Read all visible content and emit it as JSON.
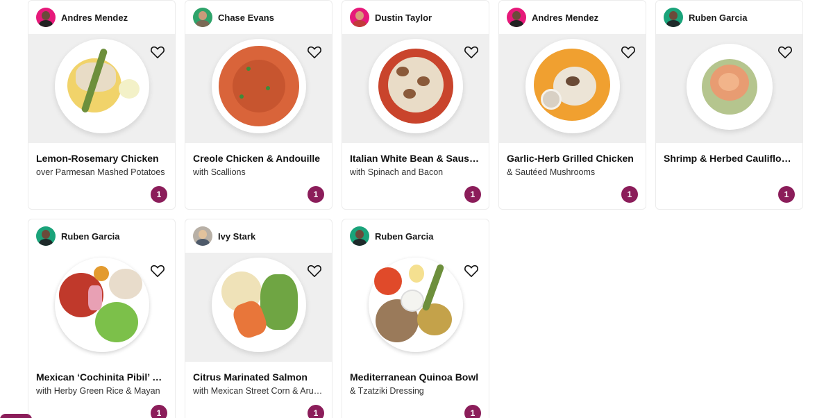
{
  "colors": {
    "accent": "#8b1d5a",
    "card_border": "#ececec",
    "photo_bg": "#efefef"
  },
  "cards": [
    {
      "chef": "Andres Mendez",
      "title": "Lemon-Rosemary Chicken",
      "subtitle": "over Parmesan Mashed Potatoes",
      "quantity": "1",
      "avatar_color": "#e6197a",
      "food": "yellow-mash-chicken"
    },
    {
      "chef": "Chase Evans",
      "title": "Creole Chicken & Andouille",
      "subtitle": "with Scallions",
      "quantity": "1",
      "avatar_color": "#2ea36a",
      "food": "red-rice"
    },
    {
      "chef": "Dustin Taylor",
      "title": "Italian White Bean & Sausage",
      "subtitle": "with Spinach and Bacon",
      "quantity": "1",
      "avatar_color": "#e6197a",
      "food": "bean-stew"
    },
    {
      "chef": "Andres Mendez",
      "title": "Garlic-Herb Grilled Chicken",
      "subtitle": "& Sautéed Mushrooms",
      "quantity": "1",
      "avatar_color": "#e6197a",
      "food": "orange-puree"
    },
    {
      "chef": "Ruben Garcia",
      "title": "Shrimp & Herbed Cauliflower",
      "subtitle": "",
      "quantity": "1",
      "avatar_color": "#1aa37a",
      "food": "shrimp-greens"
    },
    {
      "chef": "Ruben Garcia",
      "title": "Mexican ‘Cochinita Pibil’ Bowl",
      "subtitle": "with Herby Green Rice & Mayan",
      "quantity": "1",
      "avatar_color": "#1aa37a",
      "food": "pibil-bowl"
    },
    {
      "chef": "Ivy Stark",
      "title": "Citrus Marinated Salmon",
      "subtitle": "with Mexican Street Corn & Arugula",
      "quantity": "1",
      "avatar_color": "#b8b0a6",
      "food": "salmon"
    },
    {
      "chef": "Ruben Garcia",
      "title": "Mediterranean Quinoa Bowl",
      "subtitle": "& Tzatziki Dressing",
      "quantity": "1",
      "avatar_color": "#1aa37a",
      "food": "quinoa-bowl"
    }
  ]
}
